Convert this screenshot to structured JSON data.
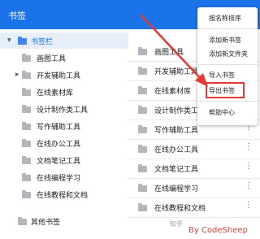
{
  "app": {
    "title": "书签",
    "kebab": "⋮"
  },
  "tree": {
    "root": {
      "label": "书签栏",
      "caret": "▼"
    },
    "items": [
      {
        "label": "画图工具"
      },
      {
        "label": "开发辅助工具",
        "caret": "▶"
      },
      {
        "label": "在线素材库"
      },
      {
        "label": "设计制作类工具"
      },
      {
        "label": "写作辅助工具"
      },
      {
        "label": "在线办公工具"
      },
      {
        "label": "文档笔记工具"
      },
      {
        "label": "在线编程学习"
      },
      {
        "label": "在线教程和文档"
      }
    ],
    "other": {
      "label": "其他书签"
    }
  },
  "list": {
    "rows": [
      {
        "label": "画图工具",
        "kebab": "⋮"
      },
      {
        "label": "开发辅助工具",
        "kebab": "⋮"
      },
      {
        "label": "在线素材库",
        "kebab": "⋮"
      },
      {
        "label": "设计制作类工具",
        "kebab": "⋮"
      },
      {
        "label": "写作辅助工具",
        "kebab": "⋮"
      },
      {
        "label": "在线办公工具",
        "kebab": "⋮"
      },
      {
        "label": "文档笔记工具",
        "kebab": "⋮"
      },
      {
        "label": "在线编程学习",
        "kebab": "⋮"
      },
      {
        "label": "在线教程和文档",
        "kebab": "⋮"
      }
    ]
  },
  "menu": {
    "sort": "按名称排序",
    "add_bookmark": "添加新书签",
    "add_folder": "添加新文件夹",
    "import": "导入书签",
    "export": "导出书签",
    "help": "帮助中心"
  },
  "watermark": "知乎",
  "signature": "By CodeSheep",
  "colors": {
    "topbar": "#1a73e8",
    "annotation": "#e53935",
    "folder": "#b3b6ba"
  }
}
